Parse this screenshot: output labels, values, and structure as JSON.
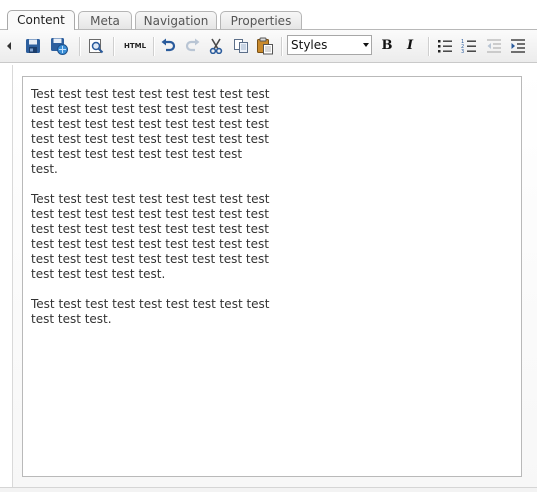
{
  "tabs": [
    {
      "label": "Content",
      "active": true
    },
    {
      "label": "Meta",
      "active": false
    },
    {
      "label": "Navigation",
      "active": false
    },
    {
      "label": "Properties",
      "active": false
    }
  ],
  "toolbar": {
    "html_label": "HTML",
    "styles_value": "Styles",
    "bold_label": "B",
    "italic_label": "I"
  },
  "editor": {
    "paragraphs": [
      "Test test test test test test test test test test test test test test test test test test test test test test test test test test test test test test test test test test test test test test test test test test test test test.",
      "Test test test test test test test test test test test test test test test test test test test test test test test test test test test test test test test test test test test test test test test test test test test test test test test test test test.",
      "Test test test test test test test test test test test test."
    ]
  },
  "colors": {
    "accent": "#2a5b9c",
    "disabled": "#b9c5d4"
  }
}
